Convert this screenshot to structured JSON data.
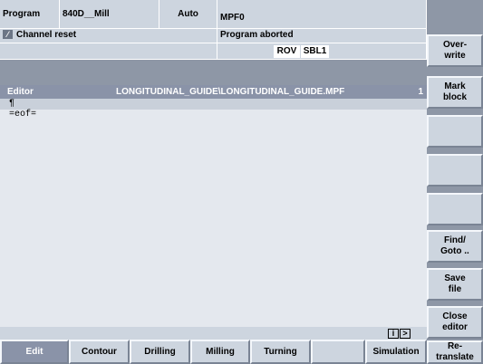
{
  "header": {
    "area": "Program",
    "machine": "840D__Mill",
    "mode": "Auto",
    "program": "MPF0",
    "channel_status": "Channel reset",
    "program_status": "Program aborted",
    "flag_1": "ROV",
    "flag_2": "SBL1"
  },
  "editor": {
    "label": "Editor",
    "path": "LONGITUDINAL_GUIDE\\LONGITUDINAL_GUIDE.MPF",
    "line_number": "1",
    "lines": [
      "¶",
      "=eof="
    ]
  },
  "status_icons": {
    "info": "i",
    "next": ">"
  },
  "vertical_softkeys": [
    "Over-\nwrite",
    "Mark\nblock",
    "",
    "",
    "",
    "Find/\nGoto ..",
    "Save\nfile",
    "Close\neditor",
    "Re-\ntranslate"
  ],
  "horizontal_softkeys": [
    "Edit",
    "Contour",
    "Drilling",
    "Milling",
    "Turning",
    "",
    "Simulation"
  ],
  "colors": {
    "panel": "#cdd5df",
    "title_bar": "#8a93a8",
    "editor_bg": "#e4e8ee",
    "active_softkey": "#8a93a8"
  }
}
